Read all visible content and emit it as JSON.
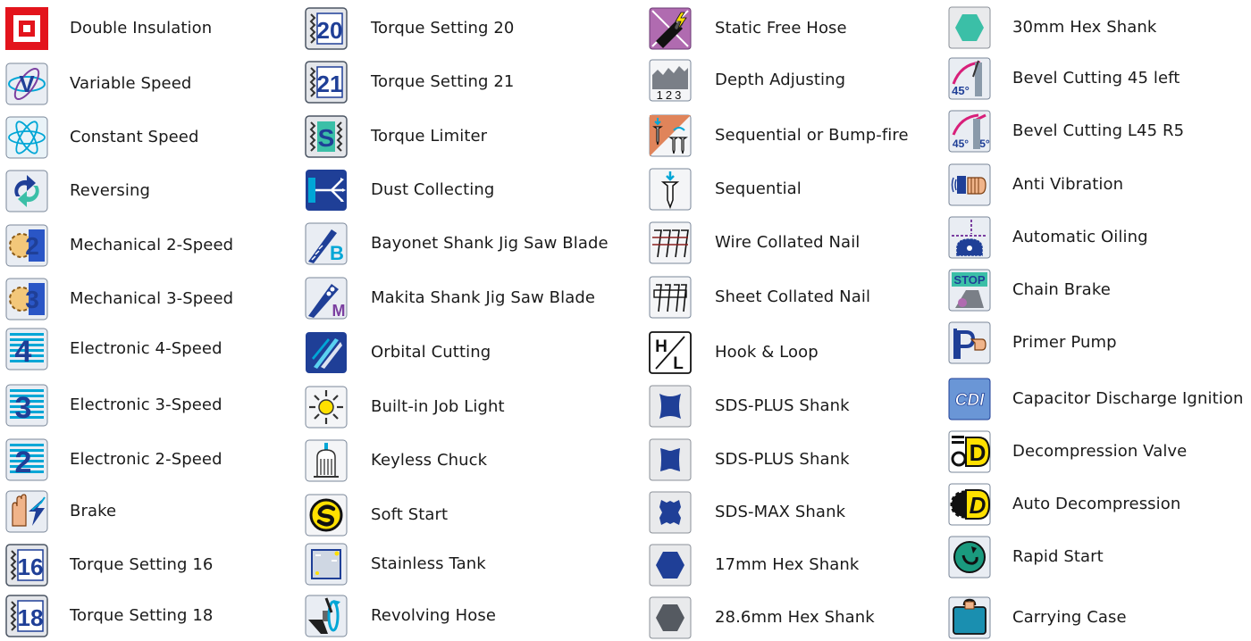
{
  "columns": [
    {
      "items": [
        {
          "label": "Double Insulation",
          "icon": "double-insulation-icon"
        },
        {
          "label": "Variable Speed",
          "icon": "variable-speed-icon"
        },
        {
          "label": "Constant Speed",
          "icon": "constant-speed-icon"
        },
        {
          "label": "Reversing",
          "icon": "reversing-icon"
        },
        {
          "label": "Mechanical 2-Speed",
          "icon": "mechanical-2-speed-icon"
        },
        {
          "label": "Mechanical 3-Speed",
          "icon": "mechanical-3-speed-icon"
        },
        {
          "label": "Electronic 4-Speed",
          "icon": "electronic-4-speed-icon"
        },
        {
          "label": "Electronic 3-Speed",
          "icon": "electronic-3-speed-icon"
        },
        {
          "label": "Electronic 2-Speed",
          "icon": "electronic-2-speed-icon"
        },
        {
          "label": "Brake",
          "icon": "brake-icon"
        },
        {
          "label": "Torque Setting 16",
          "icon": "torque-setting-16-icon"
        },
        {
          "label": "Torque Setting 18",
          "icon": "torque-setting-18-icon"
        }
      ]
    },
    {
      "items": [
        {
          "label": "Torque Setting 20",
          "icon": "torque-setting-20-icon"
        },
        {
          "label": "Torque Setting 21",
          "icon": "torque-setting-21-icon"
        },
        {
          "label": "Torque Limiter",
          "icon": "torque-limiter-icon"
        },
        {
          "label": "Dust Collecting",
          "icon": "dust-collecting-icon"
        },
        {
          "label": "Bayonet Shank Jig Saw Blade",
          "icon": "bayonet-shank-icon"
        },
        {
          "label": "Makita Shank Jig Saw Blade",
          "icon": "makita-shank-icon"
        },
        {
          "label": "Orbital Cutting",
          "icon": "orbital-cutting-icon"
        },
        {
          "label": "Built-in Job Light",
          "icon": "job-light-icon"
        },
        {
          "label": "Keyless Chuck",
          "icon": "keyless-chuck-icon"
        },
        {
          "label": "Soft Start",
          "icon": "soft-start-icon"
        },
        {
          "label": "Stainless Tank",
          "icon": "stainless-tank-icon"
        },
        {
          "label": "Revolving Hose",
          "icon": "revolving-hose-icon"
        }
      ]
    },
    {
      "items": [
        {
          "label": "Static Free Hose",
          "icon": "static-free-hose-icon"
        },
        {
          "label": "Depth Adjusting",
          "icon": "depth-adjusting-icon"
        },
        {
          "label": "Sequential or Bump-fire",
          "icon": "sequential-bump-fire-icon"
        },
        {
          "label": "Sequential",
          "icon": "sequential-icon"
        },
        {
          "label": "Wire Collated Nail",
          "icon": "wire-collated-nail-icon"
        },
        {
          "label": "Sheet Collated Nail",
          "icon": "sheet-collated-nail-icon"
        },
        {
          "label": "Hook & Loop",
          "icon": "hook-and-loop-icon"
        },
        {
          "label": "SDS-PLUS Shank",
          "icon": "sds-plus-shank-icon"
        },
        {
          "label": "SDS-PLUS Shank",
          "icon": "sds-plus-shank-alt-icon"
        },
        {
          "label": "SDS-MAX Shank",
          "icon": "sds-max-shank-icon"
        },
        {
          "label": "17mm Hex Shank",
          "icon": "hex-shank-17-icon"
        },
        {
          "label": "28.6mm Hex Shank",
          "icon": "hex-shank-28-icon"
        }
      ]
    },
    {
      "items": [
        {
          "label": "30mm Hex Shank",
          "icon": "hex-shank-30-icon"
        },
        {
          "label": "Bevel Cutting 45 left",
          "icon": "bevel-45-left-icon"
        },
        {
          "label": "Bevel Cutting L45 R5",
          "icon": "bevel-l45-r5-icon"
        },
        {
          "label": "Anti Vibration",
          "icon": "anti-vibration-icon"
        },
        {
          "label": "Automatic Oiling",
          "icon": "automatic-oiling-icon"
        },
        {
          "label": "Chain Brake",
          "icon": "chain-brake-icon"
        },
        {
          "label": "Primer Pump",
          "icon": "primer-pump-icon"
        },
        {
          "label": "Capacitor Discharge Ignition",
          "icon": "cdi-icon"
        },
        {
          "label": "Decompression Valve",
          "icon": "decompression-valve-icon"
        },
        {
          "label": "Auto Decompression",
          "icon": "auto-decompression-icon"
        },
        {
          "label": "Rapid Start",
          "icon": "rapid-start-icon"
        },
        {
          "label": "Carrying Case",
          "icon": "carrying-case-icon"
        }
      ]
    }
  ],
  "icon_text": {
    "t16": "16",
    "t18": "18",
    "t20": "20",
    "t21": "21",
    "tS": "S",
    "bay": "B",
    "mak": "M",
    "depth": "123",
    "hH": "H",
    "hL": "L",
    "b45": "45°",
    "bl45": "45°",
    "br5": "5°",
    "stop": "STOP",
    "cdi": "CDI",
    "dv": "D",
    "ad": "D"
  },
  "colors": {
    "accent_red": "#e3141c",
    "icon_blue": "#1f3f97",
    "icon_cyan": "#00a6d6",
    "icon_teal": "#3bbfa7",
    "icon_yellow": "#ffe000",
    "icon_magenta": "#d81f7a",
    "tile_gray": "#d9dadb"
  }
}
